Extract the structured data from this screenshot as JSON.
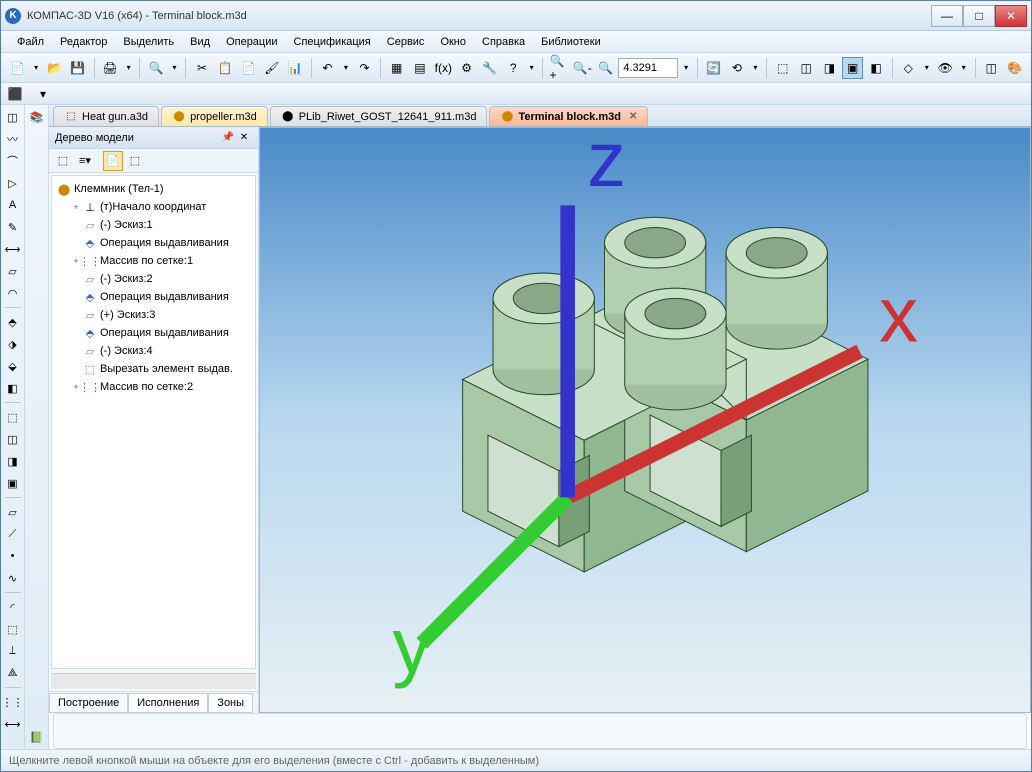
{
  "title": "КОМПАС-3D V16  (x64) - Terminal block.m3d",
  "menu": {
    "file": "Файл",
    "edit": "Редактор",
    "select": "Выделить",
    "view": "Вид",
    "ops": "Операции",
    "spec": "Спецификация",
    "service": "Сервис",
    "window": "Окно",
    "help": "Справка",
    "lib": "Библиотеки"
  },
  "toolbar": {
    "zoom_value": "4.3291"
  },
  "tabs": [
    {
      "label": "Heat gun.a3d",
      "type": "inactive-gray"
    },
    {
      "label": "propeller.m3d",
      "type": "inactive-yellow"
    },
    {
      "label": "PLib_Riwet_GOST_12641_911.m3d",
      "type": "inactive-gray"
    },
    {
      "label": "Terminal block.m3d",
      "type": "active"
    }
  ],
  "tree": {
    "title": "Дерево модели",
    "root": "Клеммник (Тел-1)",
    "nodes": [
      {
        "label": "(т)Начало координат",
        "icon": "axis",
        "expand": "+"
      },
      {
        "label": "(-) Эскиз:1",
        "icon": "sketch",
        "expand": ""
      },
      {
        "label": "Операция выдавливания",
        "icon": "extrude",
        "expand": ""
      },
      {
        "label": "Массив по сетке:1",
        "icon": "array",
        "expand": "+"
      },
      {
        "label": "(-) Эскиз:2",
        "icon": "sketch",
        "expand": ""
      },
      {
        "label": "Операция выдавливания",
        "icon": "extrude",
        "expand": ""
      },
      {
        "label": "(+) Эскиз:3",
        "icon": "sketch",
        "expand": ""
      },
      {
        "label": "Операция выдавливания",
        "icon": "extrude",
        "expand": ""
      },
      {
        "label": "(-) Эскиз:4",
        "icon": "sketch",
        "expand": ""
      },
      {
        "label": "Вырезать элемент выдав.",
        "icon": "cut",
        "expand": ""
      },
      {
        "label": "Массив по сетке:2",
        "icon": "array",
        "expand": "+"
      }
    ],
    "tabs": {
      "build": "Построение",
      "exec": "Исполнения",
      "zones": "Зоны"
    }
  },
  "status": "Щелкните левой кнопкой мыши на объекте для его выделения (вместе с Ctrl - добавить к выделенным)",
  "axis": {
    "x": "x",
    "y": "y",
    "z": "z"
  }
}
